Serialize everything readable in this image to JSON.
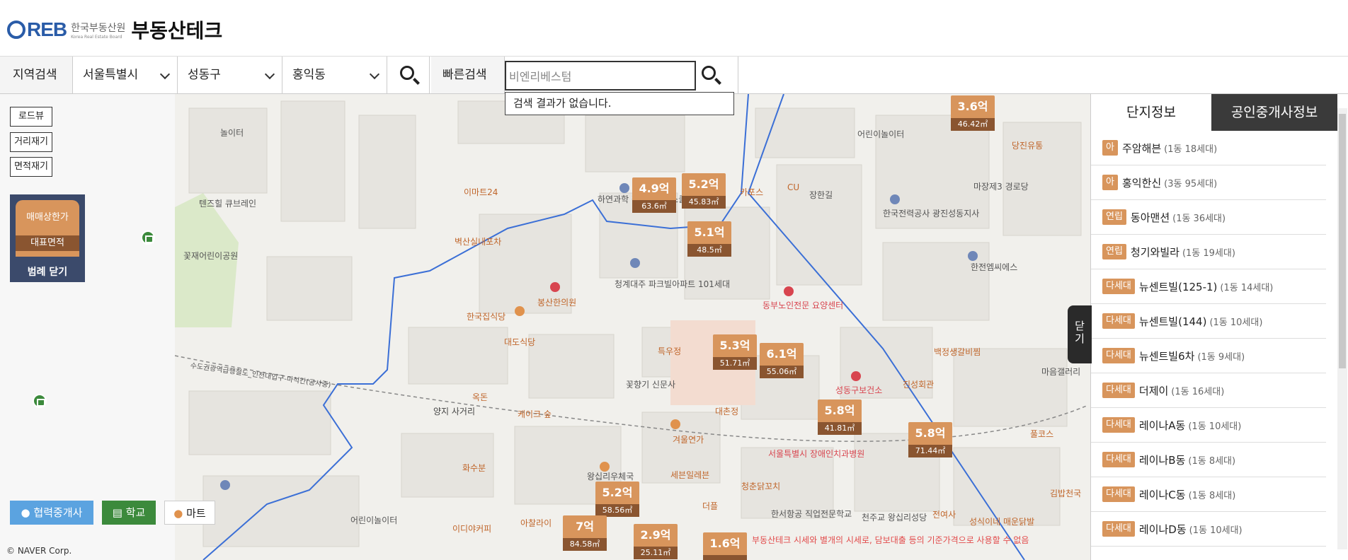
{
  "header": {
    "logo_reb": "REB",
    "logo_org": "한국부동산원",
    "logo_org_en": "Korea Real Estate Board",
    "title": "부동산테크"
  },
  "search": {
    "region_label": "지역검색",
    "city": "서울특별시",
    "district": "성동구",
    "dong": "홍익동",
    "quick_label": "빠른검색",
    "quick_value": "비엔리베스텀",
    "quick_result": "검색 결과가 없습니다."
  },
  "left": {
    "roadview": "로드뷰",
    "measure_distance": "거리재기",
    "measure_area": "면적재기",
    "legend_price": "매매상한가",
    "legend_area": "대표면적",
    "legend_close": "범례 닫기",
    "btn_agent": "협력중개사",
    "btn_school": "학교",
    "btn_mart": "마트",
    "copyright": "© NAVER Corp."
  },
  "map": {
    "places": [
      {
        "text": "놀이터"
      },
      {
        "text": "텐즈힐 큐브레인"
      },
      {
        "text": "꽃재어린이공원"
      },
      {
        "text": "이마트24"
      },
      {
        "text": "하연과학 청계벽산플스쿨"
      },
      {
        "text": "청계대주 파크빌아파트 101세대"
      },
      {
        "text": "벽산실내포차"
      },
      {
        "text": "봉산한의원"
      },
      {
        "text": "한국집식당"
      },
      {
        "text": "대도식당"
      },
      {
        "text": "특우정"
      },
      {
        "text": "꽃향기 신문사"
      },
      {
        "text": "옥돈"
      },
      {
        "text": "케이크 숲"
      },
      {
        "text": "양지 사거리"
      },
      {
        "text": "화수분"
      },
      {
        "text": "왕십리우체국"
      },
      {
        "text": "세븐일레븐"
      },
      {
        "text": "대촌정"
      },
      {
        "text": "겨울연가"
      },
      {
        "text": "동부노인전문 요양센터"
      },
      {
        "text": "성동구보건소"
      },
      {
        "text": "진성회관"
      },
      {
        "text": "서울특별시 장애인치과병원"
      },
      {
        "text": "청춘닭꼬치"
      },
      {
        "text": "더플"
      },
      {
        "text": "한서항공 직업전문학교"
      },
      {
        "text": "천주교 왕십리성당"
      },
      {
        "text": "전여사"
      },
      {
        "text": "성식이네 매운닭발"
      },
      {
        "text": "이디야커피"
      },
      {
        "text": "아찰라이"
      },
      {
        "text": "어린이놀이터"
      },
      {
        "text": "한국전력공사 광진성동지사"
      },
      {
        "text": "마장제3 경로당"
      },
      {
        "text": "한전엠씨에스"
      },
      {
        "text": "어린이놀이터"
      },
      {
        "text": "당진유통"
      },
      {
        "text": "백정생갈비찜"
      },
      {
        "text": "마음갤러리"
      },
      {
        "text": "풀코스"
      },
      {
        "text": "김밥천국"
      },
      {
        "text": "카포스"
      },
      {
        "text": "CU"
      },
      {
        "text": "장한길"
      },
      {
        "text": "수도권광역급행철도_인천대입구-마석간(공사중)"
      }
    ],
    "markers": [
      {
        "price": "3.6억",
        "area": "46.42㎡"
      },
      {
        "price": "4.9억",
        "area": "63.6㎡"
      },
      {
        "price": "5.2억",
        "area": "45.83㎡"
      },
      {
        "price": "5.1억",
        "area": "48.5㎡"
      },
      {
        "price": "5.3억",
        "area": "51.71㎡"
      },
      {
        "price": "6.1억",
        "area": "55.06㎡"
      },
      {
        "price": "5.8억",
        "area": "41.81㎡"
      },
      {
        "price": "5.8억",
        "area": "71.44㎡"
      },
      {
        "price": "5.2억",
        "area": "58.56㎡"
      },
      {
        "price": "7억",
        "area": "84.58㎡"
      },
      {
        "price": "2.9억",
        "area": "25.11㎡"
      },
      {
        "price": "1.6억",
        "area": ""
      }
    ],
    "notice": "부동산테크 시세와 별개의 시세로, 담보대출 등의 기준가격으로 사용할 수 없음"
  },
  "right": {
    "tab_complex": "단지정보",
    "tab_agent": "공인중개사정보",
    "close_label": "닫기",
    "items": [
      {
        "type": "아",
        "name": "주암해븐",
        "info": "(1동 18세대)"
      },
      {
        "type": "아",
        "name": "홍익한신",
        "info": "(3동 95세대)"
      },
      {
        "type": "연립",
        "name": "동아맨션",
        "info": "(1동 36세대)"
      },
      {
        "type": "연립",
        "name": "청기와빌라",
        "info": "(1동 19세대)"
      },
      {
        "type": "다세대",
        "name": "뉴센트빌(125-1)",
        "info": "(1동 14세대)"
      },
      {
        "type": "다세대",
        "name": "뉴센트빌(144)",
        "info": "(1동 10세대)"
      },
      {
        "type": "다세대",
        "name": "뉴센트빌6차",
        "info": "(1동 9세대)"
      },
      {
        "type": "다세대",
        "name": "더제이",
        "info": "(1동 16세대)"
      },
      {
        "type": "다세대",
        "name": "레이나A동",
        "info": "(1동 10세대)"
      },
      {
        "type": "다세대",
        "name": "레이나B동",
        "info": "(1동 8세대)"
      },
      {
        "type": "다세대",
        "name": "레이나C동",
        "info": "(1동 8세대)"
      },
      {
        "type": "다세대",
        "name": "레이나D동",
        "info": "(1동 10세대)"
      }
    ]
  },
  "colors": {
    "accent_blue": "#2a5ca8",
    "marker_price": "#d8955c",
    "marker_area": "#8a5530",
    "school_green": "#3c8a3c",
    "agent_blue": "#5ba3e0"
  }
}
